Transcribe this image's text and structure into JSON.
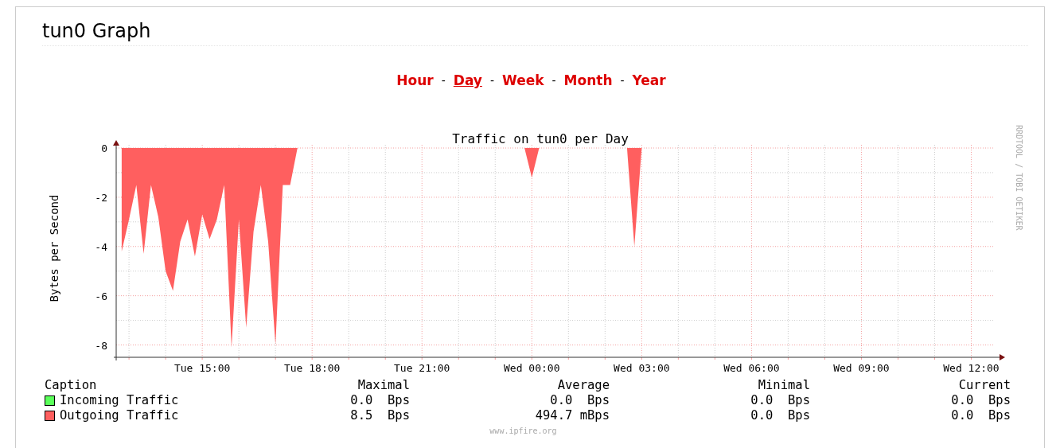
{
  "page": {
    "title": "tun0 Graph"
  },
  "nav": [
    {
      "kind": "link",
      "label": "Hour",
      "selected": false
    },
    {
      "kind": "separator",
      "text": "-"
    },
    {
      "kind": "link",
      "label": "Day",
      "selected": true
    },
    {
      "kind": "separator",
      "text": "-"
    },
    {
      "kind": "link",
      "label": "Week",
      "selected": false
    },
    {
      "kind": "separator",
      "text": "-"
    },
    {
      "kind": "link",
      "label": "Month",
      "selected": false
    },
    {
      "kind": "separator",
      "text": "-"
    },
    {
      "kind": "link",
      "label": "Year",
      "selected": false
    }
  ],
  "graph": {
    "watermark": "RRDTOOL / TOBI OETIKER",
    "footer": "www.ipfire.org",
    "chart_data": {
      "type": "area",
      "title": "Traffic on tun0 per Day",
      "ylabel": "Bytes per Second",
      "categories": [
        null,
        null,
        null,
        null,
        null,
        null,
        null,
        null,
        null,
        null,
        null,
        "Tue 15:00",
        null,
        null,
        null,
        null,
        null,
        null,
        null,
        null,
        null,
        null,
        null,
        null,
        null,
        null,
        "Tue 18:00",
        null,
        null,
        null,
        null,
        null,
        null,
        null,
        null,
        null,
        null,
        null,
        null,
        null,
        null,
        "Tue 21:00",
        null,
        null,
        null,
        null,
        null,
        null,
        null,
        null,
        null,
        null,
        null,
        null,
        null,
        null,
        "Wed 00:00",
        null,
        null,
        null,
        null,
        null,
        null,
        null,
        null,
        null,
        null,
        null,
        null,
        null,
        null,
        "Wed 03:00",
        null,
        null,
        null,
        null,
        null,
        null,
        null,
        null,
        null,
        null,
        null,
        null,
        null,
        null,
        "Wed 06:00",
        null,
        null,
        null,
        null,
        null,
        null,
        null,
        null,
        null,
        null,
        null,
        null,
        null,
        null,
        "Wed 09:00",
        null,
        null,
        null,
        null,
        null,
        null,
        null,
        null,
        null,
        null,
        null,
        null,
        null,
        null,
        "Wed 12:00",
        null,
        null,
        null
      ],
      "series": [
        {
          "name": "Outgoing Traffic",
          "color": "#ff5f5f",
          "values": [
            -4.2,
            -2.9,
            -1.5,
            -4.3,
            -1.5,
            -2.8,
            -5.0,
            -5.8,
            -3.8,
            -2.9,
            -4.4,
            -2.7,
            -3.7,
            -2.9,
            -1.5,
            -8.1,
            -2.9,
            -7.3,
            -3.4,
            -1.5,
            -3.8,
            -8.0,
            -1.5,
            -1.5,
            0,
            0,
            0,
            0,
            0,
            0,
            0,
            0,
            0,
            0,
            0,
            0,
            0,
            0,
            0,
            0,
            0,
            0,
            0,
            0,
            0,
            0,
            0,
            0,
            0,
            0,
            0,
            0,
            0,
            0,
            0,
            0,
            -1.2,
            0,
            0,
            0,
            0,
            0,
            0,
            0,
            0,
            0,
            0,
            0,
            0,
            0,
            -4.0,
            0,
            0,
            0,
            0,
            0,
            0,
            0,
            0,
            0,
            0,
            0,
            0,
            0,
            0,
            0,
            0,
            0,
            0,
            0,
            0,
            0,
            0,
            0,
            0,
            0,
            0,
            0,
            0,
            0,
            0,
            0,
            0,
            0,
            0,
            0,
            0,
            0,
            0,
            0,
            0,
            0,
            0,
            0,
            0,
            0,
            0,
            0,
            0,
            0
          ]
        }
      ],
      "ylim": [
        -8.5,
        0
      ],
      "grid": true,
      "yticks": [
        0,
        -2,
        -4,
        -6,
        -8
      ]
    }
  },
  "legend": {
    "columns": [
      "Caption",
      "Maximal",
      "Average",
      "Minimal",
      "Current"
    ],
    "rows": [
      {
        "kind": "entry",
        "name": "Incoming Traffic",
        "color": "#5aff5a",
        "maximal": "0.0  Bps",
        "average": "0.0  Bps",
        "minimal": "0.0  Bps",
        "current": "0.0  Bps"
      },
      {
        "kind": "series",
        "maximal": "8.5  Bps",
        "average": "494.7 mBps",
        "minimal": "0.0  Bps",
        "current": "0.0  Bps"
      }
    ]
  }
}
